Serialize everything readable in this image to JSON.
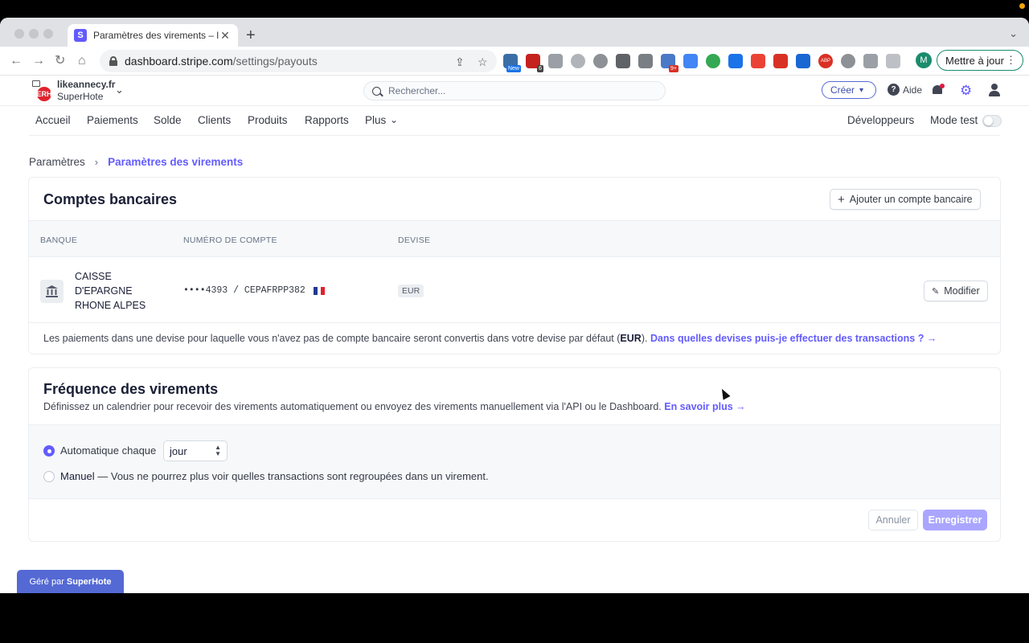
{
  "browser": {
    "tab_title": "Paramètres des virements – lik",
    "tab_favicon": "S",
    "url_host": "dashboard.stripe.com",
    "url_path": "/settings/payouts",
    "profile_initial": "M",
    "update_button": "Mettre à jour",
    "extension_badges": {
      "new": "New",
      "six": "6",
      "nine_plus": "9+",
      "abp": "ABP"
    }
  },
  "header": {
    "account_name": "likeannecy.fr",
    "account_sub": "SuperHote",
    "logo_text": "ERH",
    "search_placeholder": "Rechercher...",
    "create_label": "Créer",
    "help_label": "Aide"
  },
  "nav": {
    "items": [
      "Accueil",
      "Paiements",
      "Solde",
      "Clients",
      "Produits",
      "Rapports",
      "Plus"
    ],
    "developers": "Développeurs",
    "test_mode": "Mode test"
  },
  "breadcrumb": {
    "parent": "Paramètres",
    "current": "Paramètres des virements"
  },
  "bank_accounts": {
    "title": "Comptes bancaires",
    "add_button": "Ajouter un compte bancaire",
    "columns": [
      "BANQUE",
      "NUMÉRO DE COMPTE",
      "DEVISE"
    ],
    "rows": [
      {
        "bank": "CAISSE D'EPARGNE RHONE ALPES",
        "account": "••••4393 / CEPAFRPP382",
        "currency": "EUR",
        "edit_label": "Modifier"
      }
    ],
    "footnote_text": "Les paiements dans une devise pour laquelle vous n'avez pas de compte bancaire seront convertis dans votre devise par défaut (",
    "footnote_currency": "EUR",
    "footnote_end": ").",
    "footnote_link": "Dans quelles devises puis-je effectuer des transactions ? →"
  },
  "payout_schedule": {
    "title": "Fréquence des virements",
    "description": "Définissez un calendrier pour recevoir des virements automatiquement ou envoyez des virements manuellement via l'API ou le Dashboard.",
    "learn_more": "En savoir plus →",
    "automatic_label": "Automatique chaque",
    "interval_value": "jour",
    "manual_label": "Manuel",
    "manual_note": " — Vous ne pourrez plus voir quelles transactions sont regroupées dans un virement.",
    "cancel_button": "Annuler",
    "save_button": "Enregistrer"
  },
  "managed_by": {
    "prefix": "Géré par",
    "name": "SuperHote"
  },
  "colors": {
    "accent": "#635bff",
    "managed_bar": "#5469d4"
  }
}
